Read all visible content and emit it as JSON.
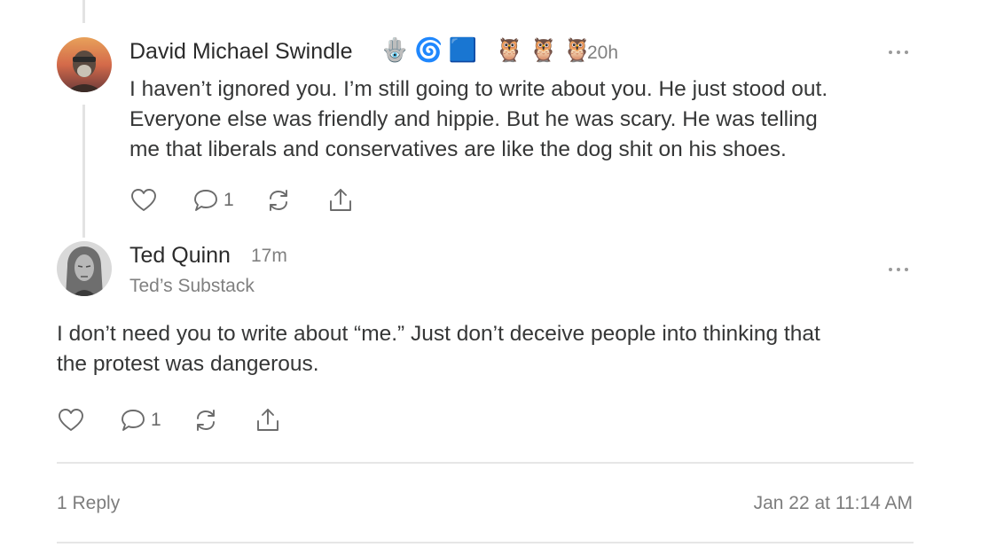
{
  "comment1": {
    "author": "David Michael Swindle",
    "badges": [
      "🪬",
      "🌀",
      "🟦",
      "🦉",
      "🦉",
      "🦉"
    ],
    "time": "20h",
    "text": "I haven’t ignored you. I’m still going to write about you. He just stood out.\nEveryone else was friendly and hippie. But he was scary. He was telling\nme that liberals and conservatives are like the dog shit on his shoes.",
    "reply_count": "1"
  },
  "comment2": {
    "author": "Ted Quinn",
    "time": "17m",
    "publication": "Ted’s Substack",
    "text": "I don’t need you to write about “me.” Just don’t deceive people into thinking that\nthe protest was dangerous.",
    "reply_count": "1"
  },
  "footer": {
    "replies": "1 Reply",
    "date": "Jan 22 at 11:14 AM"
  }
}
